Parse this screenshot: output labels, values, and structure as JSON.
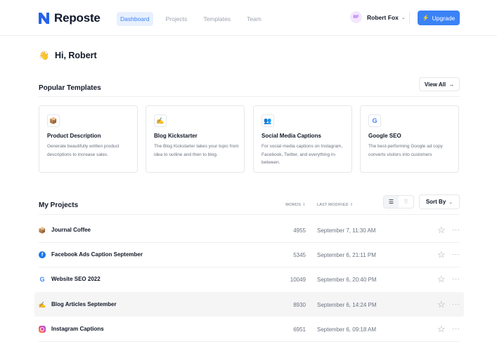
{
  "app": {
    "name": "Reposte"
  },
  "nav": {
    "items": [
      "Dashboard",
      "Projects",
      "Templates",
      "Team"
    ],
    "active": "Dashboard"
  },
  "user": {
    "initials": "RF",
    "name": "Robert Fox"
  },
  "upgrade_label": "Upgrade",
  "greeting": {
    "emoji": "👋",
    "text": "Hi, Robert"
  },
  "popular_templates": {
    "title": "Popular Templates",
    "view_all_label": "View All",
    "cards": [
      {
        "icon": "box-icon",
        "glyph": "📦",
        "title": "Product Description",
        "description": "Generate beautifully written product descriptions to increase sales."
      },
      {
        "icon": "writing-hand-icon",
        "glyph": "✍️",
        "title": "Blog Kickstarter",
        "description": "The Blog Kickstarter takes your topic from idea to outline and then to blog."
      },
      {
        "icon": "people-icon",
        "glyph": "👥",
        "title": "Social Media Captions",
        "description": "For social media captions on Instagram, Facebook, Twitter, and everything in-between."
      },
      {
        "icon": "google-icon",
        "glyph": "G",
        "title": "Google SEO",
        "description": "The best-performing Google ad copy converts visitors into customers"
      }
    ]
  },
  "my_projects": {
    "title": "My Projects",
    "columns": {
      "words": "WORDS",
      "last_modified": "LAST MODIFIED"
    },
    "sort_label": "Sort By",
    "rows": [
      {
        "icon": "box-icon",
        "name": "Journal Coffee",
        "words": "4955",
        "modified": "September 7, 11:30 AM"
      },
      {
        "icon": "facebook-icon",
        "name": "Facebook Ads Caption September",
        "words": "5345",
        "modified": "September 6, 21:11 PM"
      },
      {
        "icon": "google-icon",
        "name": "Website SEO 2022",
        "words": "10049",
        "modified": "September 6, 20:40 PM"
      },
      {
        "icon": "writing-hand-icon",
        "name": "Blog Articles September",
        "words": "8930",
        "modified": "September 6, 14:24 PM"
      },
      {
        "icon": "instagram-icon",
        "name": "Instagram Captions",
        "words": "6951",
        "modified": "September 6, 09:18 AM"
      }
    ]
  },
  "colors": {
    "accent": "#3b82f6",
    "highlight_row": "#f5f5f6"
  }
}
